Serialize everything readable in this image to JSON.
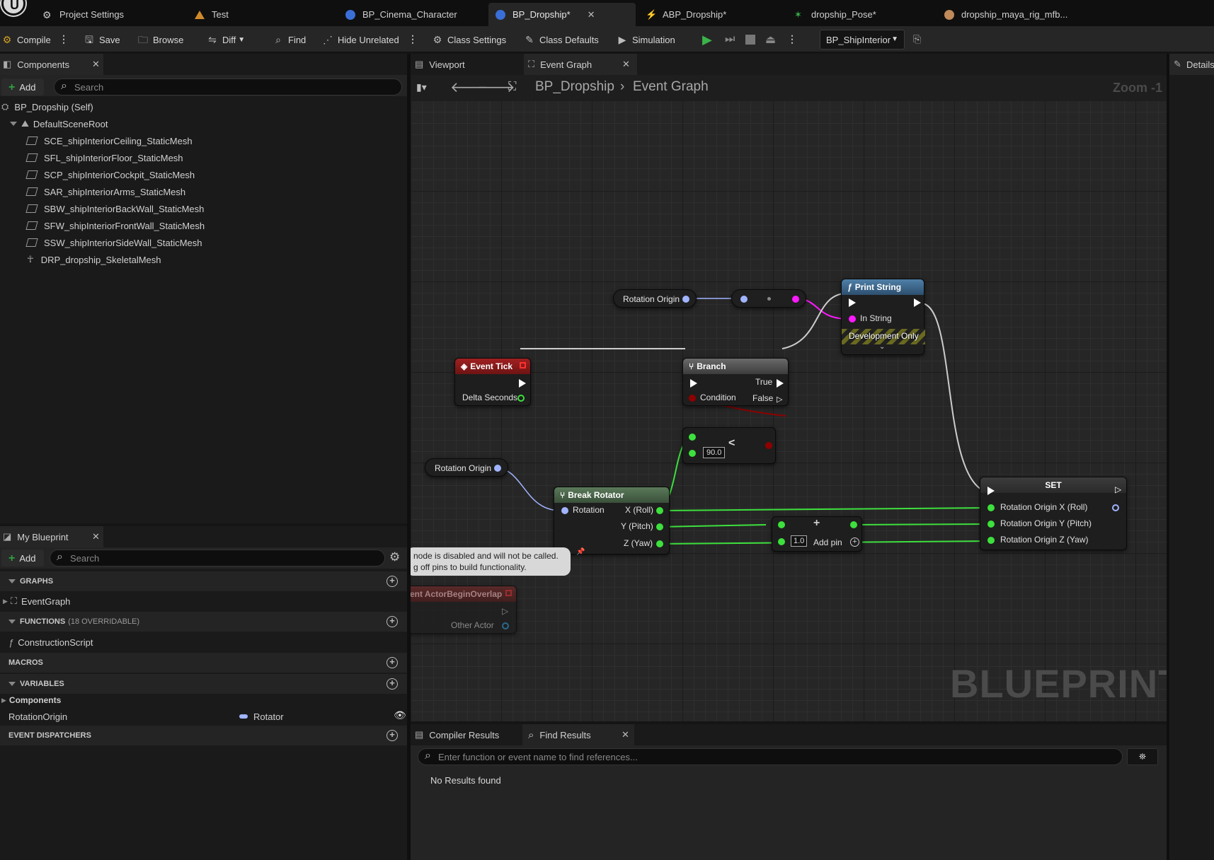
{
  "tabs": [
    {
      "label": "Project Settings",
      "icon": "settings-icon"
    },
    {
      "label": "Test",
      "icon": "level-icon"
    },
    {
      "label": "BP_Cinema_Character",
      "icon": "blueprint-icon"
    },
    {
      "label": "BP_Dropship*",
      "icon": "blueprint-icon",
      "active": true
    },
    {
      "label": "ABP_Dropship*",
      "icon": "anim-blueprint-icon"
    },
    {
      "label": "dropship_Pose*",
      "icon": "pose-icon"
    },
    {
      "label": "dropship_maya_rig_mfb...",
      "icon": "skeleton-icon"
    }
  ],
  "toolbar": {
    "compile": "Compile",
    "save": "Save",
    "browse": "Browse",
    "diff": "Diff",
    "find": "Find",
    "hide_unrelated": "Hide Unrelated",
    "class_settings": "Class Settings",
    "class_defaults": "Class Defaults",
    "simulation": "Simulation",
    "debug_object": "BP_ShipInterior"
  },
  "components_panel": {
    "title": "Components",
    "add": "Add",
    "search_placeholder": "Search",
    "root": "BP_Dropship (Self)",
    "scene_root": "DefaultSceneRoot",
    "items": [
      "SCE_shipInteriorCeiling_StaticMesh",
      "SFL_shipInteriorFloor_StaticMesh",
      "SCP_shipInteriorCockpit_StaticMesh",
      "SAR_shipInteriorArms_StaticMesh",
      "SBW_shipInteriorBackWall_StaticMesh",
      "SFW_shipInteriorFrontWall_StaticMesh",
      "SSW_shipInteriorSideWall_StaticMesh",
      "DRP_dropship_SkeletalMesh"
    ]
  },
  "my_blueprint": {
    "title": "My Blueprint",
    "add": "Add",
    "search_placeholder": "Search",
    "graphs": "GRAPHS",
    "event_graph": "EventGraph",
    "functions": "FUNCTIONS",
    "functions_count": "(18 OVERRIDABLE)",
    "construction_script": "ConstructionScript",
    "macros": "MACROS",
    "variables": "VARIABLES",
    "components": "Components",
    "variable_name": "RotationOrigin",
    "variable_type": "Rotator",
    "event_dispatchers": "EVENT DISPATCHERS"
  },
  "editor_tabs": {
    "viewport": "Viewport",
    "event_graph": "Event Graph",
    "details": "Details"
  },
  "graph": {
    "breadcrumb_root": "BP_Dropship",
    "breadcrumb_leaf": "Event Graph",
    "zoom": "Zoom -1",
    "watermark": "BLUEPRINT",
    "nodes": {
      "rotation_origin_1": "Rotation Origin",
      "rotation_origin_2": "Rotation Origin",
      "print_string": "Print String",
      "in_string": "In String",
      "development_only": "Development Only",
      "event_tick": "Event Tick",
      "delta_seconds": "Delta Seconds",
      "branch": "Branch",
      "true": "True",
      "false": "False",
      "condition": "Condition",
      "less_value": "90.0",
      "less_op": "<",
      "break_rotator": "Break Rotator",
      "rotation": "Rotation",
      "x_roll": "X (Roll)",
      "y_pitch": "Y (Pitch)",
      "z_yaw": "Z (Yaw)",
      "add_value": "1.0",
      "add_pin": "Add pin",
      "set": "SET",
      "set_x": "Rotation Origin X (Roll)",
      "set_y": "Rotation Origin Y (Pitch)",
      "set_z": "Rotation Origin Z (Yaw)",
      "disabled_line1": "node is disabled and will not be called.",
      "disabled_line2": "g off pins to build functionality.",
      "actor_overlap": "ent ActorBeginOverlap",
      "other_actor": "Other Actor"
    }
  },
  "results": {
    "compiler_results": "Compiler Results",
    "find_results": "Find Results",
    "search_placeholder": "Enter function or event name to find references...",
    "status": "No Results found"
  },
  "colors": {
    "exec": "#ffffff",
    "rotator": "#a0b4ff",
    "float": "#3de03d",
    "string": "#ff19ff",
    "bool": "#8e0000",
    "accent_green": "#3ab34a"
  }
}
